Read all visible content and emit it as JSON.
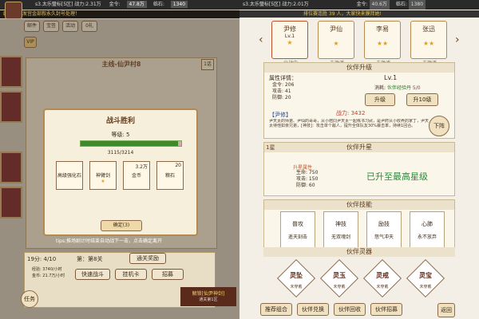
{
  "left": {
    "topbar": {
      "player": "s3.太乐璧标[5区] 战力:2.31万",
      "gold_label": "金令:",
      "gold": "47.8万",
      "yuan_label": "临石:",
      "yuan": "1340"
    },
    "marquee": "剧一经被发宫金部叙永久封号处理！",
    "top_buttons": [
      "邮件",
      "宝签",
      "活动",
      "0礼"
    ],
    "vip": "VIP",
    "story_title": "主线-仙尹村8",
    "story_badge": "1话",
    "dialog": {
      "title": "战斗胜利",
      "level_label": "等级: 5",
      "exp": "3115/3214",
      "exp_fraction": 0.97,
      "items": [
        {
          "name": "高级强化石",
          "count": ""
        },
        {
          "name": "神臂剑",
          "count": ""
        },
        {
          "name": "金币",
          "count": "3.2万"
        },
        {
          "name": "粮石",
          "count": "20"
        }
      ],
      "confirm": "确定(3)"
    },
    "tips": "tips:推场剧计时结束自动战下一击，点击确定离开",
    "bottom": {
      "progress": "19分: 4/10",
      "chapter": "第：第8关",
      "reward_btn": "通关奖励",
      "stat1": "经验: 3740/小时",
      "stat2": "金币: 21.7万/小时",
      "buttons": [
        "快速战斗",
        "挂机卡",
        "招募"
      ],
      "task": "任务",
      "unlock": "解锁[仙尹神剑]",
      "unlock_sub": "通关第1区"
    }
  },
  "right": {
    "topbar": {
      "player": "s3.太乐璧标[5区] 战力:2.01万",
      "gold_label": "金令:",
      "gold": "40.6万",
      "yuan_label": "临石:",
      "yuan": "1380"
    },
    "marquee": "排位赛连胜 39 人，大家快来膜拜她!",
    "heroes": [
      {
        "name": "尹修",
        "sub": "Lv.1",
        "stars": "★",
        "status": "出战中"
      },
      {
        "name": "尹仙",
        "sub": "",
        "stars": "★",
        "status": "未激活"
      },
      {
        "name": "李易",
        "sub": "",
        "stars": "★★",
        "status": "未激活"
      },
      {
        "name": "张迅",
        "sub": "",
        "stars": "★★",
        "status": "未激活"
      }
    ],
    "upgrade": {
      "title": "伙伴升级",
      "level": "Lv.1",
      "attr_label": "属性详情：",
      "attrs": [
        "金令: 206",
        "攻击: 41",
        "防御: 20"
      ],
      "cost_label": "消耗: ",
      "cost_item": "伙伴经验丹",
      "cost_count": "5/0",
      "btn1": "升级",
      "btn2": "升10级",
      "hero_name": "【尹修】",
      "power": "战力: 3432",
      "desc": "尹天太的师弟、尹仙的哥哥，从小陪同尹天太一起练书习武，是尹府从小收养的家丁，尹天太待他如亲兄弟，[神技]：攻击单个敌人，提升全体队友30%暴击率，持续1回合。",
      "fall_btn": "下阵"
    },
    "star": {
      "title": "伙伴升星",
      "badge": "1星",
      "attr_title": "升星属性",
      "attrs": [
        "生命: 750",
        "攻击: 150",
        "防御: 60"
      ],
      "maxed": "已升至最高星级"
    },
    "skills": {
      "title": "伙伴技能",
      "items": [
        {
          "name": "普攻",
          "desc": "遥天刻击"
        },
        {
          "name": "神技",
          "desc": "无双魂剑"
        },
        {
          "name": "励技",
          "desc": "怒气冲天"
        },
        {
          "name": "心肺",
          "desc": "永不放弃"
        }
      ]
    },
    "spirits": {
      "title": "伙伴灵器",
      "items": [
        {
          "name": "灵坠",
          "status": "未穿戴"
        },
        {
          "name": "灵玉",
          "status": "未穿戴"
        },
        {
          "name": "灵戒",
          "status": "未穿戴"
        },
        {
          "name": "灵宝",
          "status": "未穿戴"
        }
      ]
    },
    "bottom_buttons": [
      "推荐组合",
      "伙伴兑换",
      "伙伴回收",
      "伙伴招募"
    ],
    "back": "返回"
  }
}
